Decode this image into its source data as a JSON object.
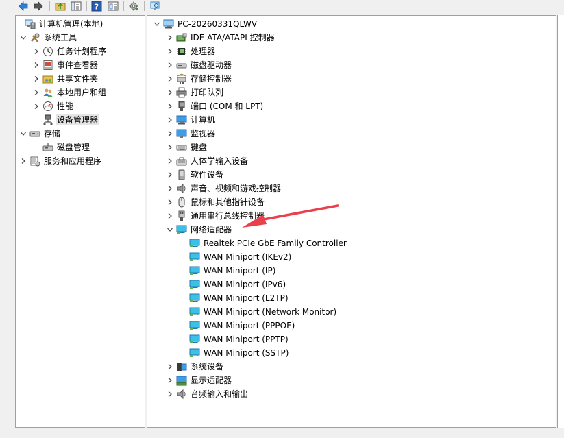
{
  "colors": {
    "arrow": "#e8414d",
    "selection": "#e5e5e5",
    "accent": "#1f6fbf"
  },
  "toolbar": {
    "icons": [
      "back-arrow-icon",
      "forward-arrow-icon",
      "up-folder-icon",
      "show-hide-tree-icon",
      "help-icon",
      "properties-icon",
      "action-icon",
      "scan-hardware-icon"
    ]
  },
  "left_tree": {
    "root": "计算机管理(本地)",
    "system_tools": "系统工具",
    "task_scheduler": "任务计划程序",
    "event_viewer": "事件查看器",
    "shared_folders": "共享文件夹",
    "local_users_groups": "本地用户和组",
    "performance": "性能",
    "device_manager": "设备管理器",
    "storage": "存储",
    "disk_management": "磁盘管理",
    "services_apps": "服务和应用程序"
  },
  "device_tree": {
    "computer_name": "PC-20260331QLWV",
    "categories": [
      {
        "label": "IDE ATA/ATAPI 控制器",
        "icon": "ide-controller-icon"
      },
      {
        "label": "处理器",
        "icon": "processor-icon"
      },
      {
        "label": "磁盘驱动器",
        "icon": "disk-drive-icon"
      },
      {
        "label": "存储控制器",
        "icon": "storage-controller-icon"
      },
      {
        "label": "打印队列",
        "icon": "printer-icon"
      },
      {
        "label": "端口 (COM 和 LPT)",
        "icon": "port-icon"
      },
      {
        "label": "计算机",
        "icon": "computer-icon"
      },
      {
        "label": "监视器",
        "icon": "monitor-icon"
      },
      {
        "label": "键盘",
        "icon": "keyboard-icon"
      },
      {
        "label": "人体学输入设备",
        "icon": "hid-icon"
      },
      {
        "label": "软件设备",
        "icon": "software-device-icon"
      },
      {
        "label": "声音、视频和游戏控制器",
        "icon": "speaker-icon"
      },
      {
        "label": "鼠标和其他指针设备",
        "icon": "mouse-icon"
      },
      {
        "label": "通用串行总线控制器",
        "icon": "usb-icon"
      },
      {
        "label": "网络适配器",
        "icon": "network-adapter-icon",
        "expanded": true
      },
      {
        "label": "系统设备",
        "icon": "system-device-icon"
      },
      {
        "label": "显示适配器",
        "icon": "display-adapter-icon"
      },
      {
        "label": "音频输入和输出",
        "icon": "audio-io-icon"
      }
    ],
    "network_adapters": [
      "Realtek PCIe GbE Family Controller",
      "WAN Miniport (IKEv2)",
      "WAN Miniport (IP)",
      "WAN Miniport (IPv6)",
      "WAN Miniport (L2TP)",
      "WAN Miniport (Network Monitor)",
      "WAN Miniport (PPPOE)",
      "WAN Miniport (PPTP)",
      "WAN Miniport (SSTP)"
    ]
  }
}
